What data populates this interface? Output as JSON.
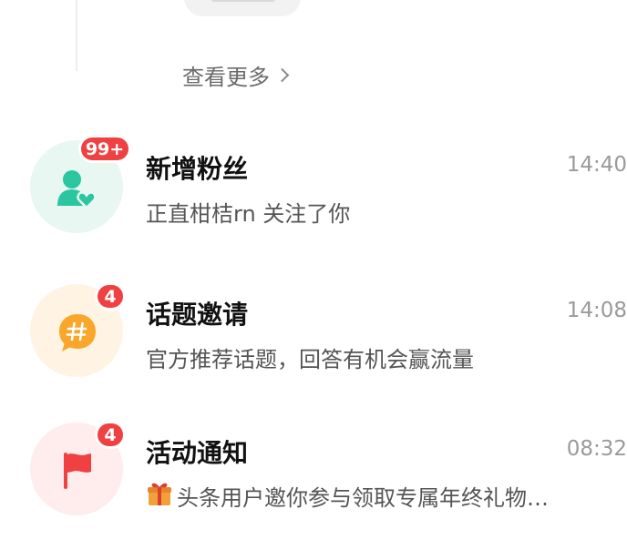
{
  "view_more": {
    "label": "查看更多",
    "icon": "chevron-right-icon"
  },
  "notifications": [
    {
      "title": "新增粉丝",
      "time": "14:40",
      "subtitle": "正直柑桔rn 关注了你",
      "badge": "99+",
      "icon": "user-heart-icon",
      "color": "#2bc6a0",
      "bg": "#e8f7f2"
    },
    {
      "title": "话题邀请",
      "time": "14:08",
      "subtitle": "官方推荐话题，回答有机会赢流量",
      "badge": "4",
      "icon": "hashtag-bubble-icon",
      "color": "#f9a72b",
      "bg": "#fff4e3"
    },
    {
      "title": "活动通知",
      "time": "08:32",
      "subtitle": "头条用户邀你参与领取专属年终礼物…",
      "prefix_icon": "gift-emoji-icon",
      "badge": "4",
      "icon": "red-flag-icon",
      "color": "#f04142",
      "bg": "#ffecec"
    }
  ],
  "colors": {
    "badge": "#f04142",
    "accent_green": "#2bc6a0",
    "accent_orange": "#f9a72b",
    "accent_red": "#f04142"
  }
}
